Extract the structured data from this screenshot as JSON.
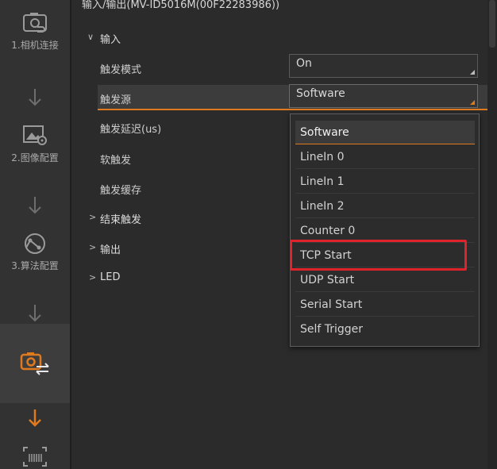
{
  "window": {
    "title": "输入/输出(MV-ID5016M(00F22283986))"
  },
  "sidebar": {
    "steps": [
      {
        "label": "1.相机连接",
        "icon": "camera-link-icon"
      },
      {
        "label": "2.图像配置",
        "icon": "image-settings-icon"
      },
      {
        "label": "3.算法配置",
        "icon": "algorithm-icon"
      },
      {
        "label": "",
        "icon": "camera-io-icon"
      },
      {
        "label": "",
        "icon": "barcode-scan-icon"
      }
    ],
    "accent_color": "#e07a1f"
  },
  "tree": {
    "input": {
      "label": "输入"
    },
    "end_trigger": {
      "label": "结束触发"
    },
    "output": {
      "label": "输出"
    },
    "led": {
      "label": "LED"
    }
  },
  "properties": {
    "trigger_mode": {
      "label": "触发模式",
      "value": "On"
    },
    "trigger_source": {
      "label": "触发源",
      "value": "Software"
    },
    "trigger_delay": {
      "label": "触发延迟(us)"
    },
    "software_trigger": {
      "label": "软触发"
    },
    "trigger_cache": {
      "label": "触发缓存"
    }
  },
  "dropdown": {
    "options": [
      "Software",
      "LineIn 0",
      "LineIn 1",
      "LineIn 2",
      "Counter 0",
      "TCP Start",
      "UDP Start",
      "Serial Start",
      "Self Trigger"
    ],
    "selected": "Software",
    "highlighted": "TCP Start",
    "highlight_color": "#e0222a"
  }
}
